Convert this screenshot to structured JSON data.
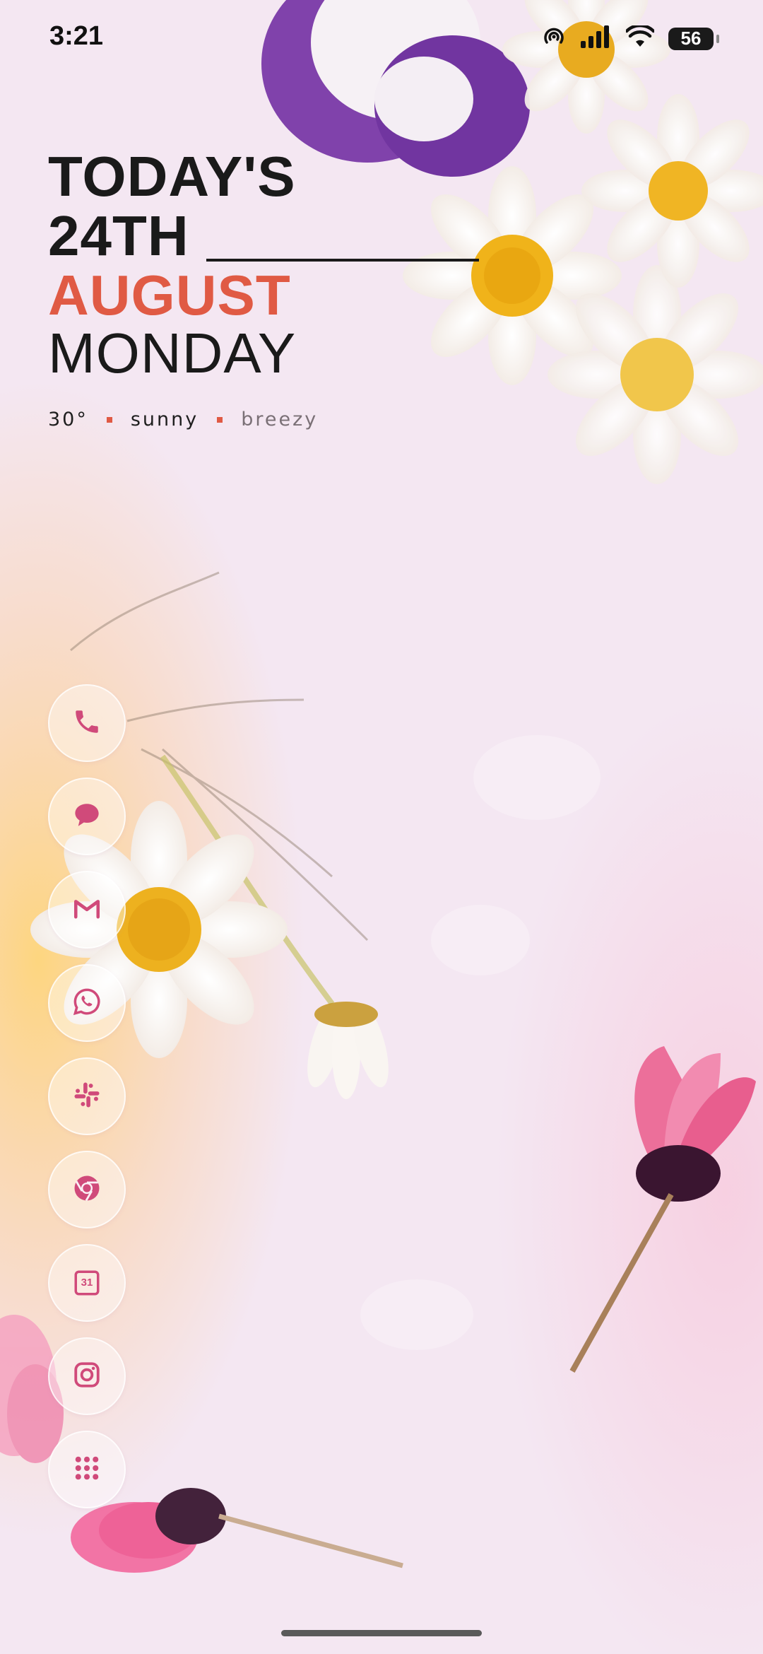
{
  "status_bar": {
    "time": "3:21",
    "battery_level": "56",
    "icons": [
      "hotspot-icon",
      "signal-icon",
      "wifi-icon",
      "battery-icon"
    ]
  },
  "date_widget": {
    "line1": "TODAY'S",
    "line2": "24TH",
    "month": "AUGUST",
    "weekday": "MONDAY",
    "weather": {
      "temperature": "30°",
      "condition": "sunny",
      "wind": "breezy"
    }
  },
  "dock": {
    "apps": [
      {
        "name": "phone",
        "icon": "phone-icon"
      },
      {
        "name": "messages",
        "icon": "chat-bubble-icon"
      },
      {
        "name": "gmail",
        "icon": "gmail-icon"
      },
      {
        "name": "whatsapp",
        "icon": "whatsapp-icon"
      },
      {
        "name": "slack",
        "icon": "slack-icon"
      },
      {
        "name": "chrome",
        "icon": "chrome-icon"
      },
      {
        "name": "calendar",
        "icon": "calendar-icon",
        "label": "31"
      },
      {
        "name": "instagram",
        "icon": "instagram-icon"
      },
      {
        "name": "app-drawer",
        "icon": "grid-icon"
      }
    ]
  },
  "colors": {
    "accent": "#e05a44",
    "icon_pink": "#d04a7a",
    "text_dark": "#1a1a1a",
    "background": "#f3e6f1"
  }
}
